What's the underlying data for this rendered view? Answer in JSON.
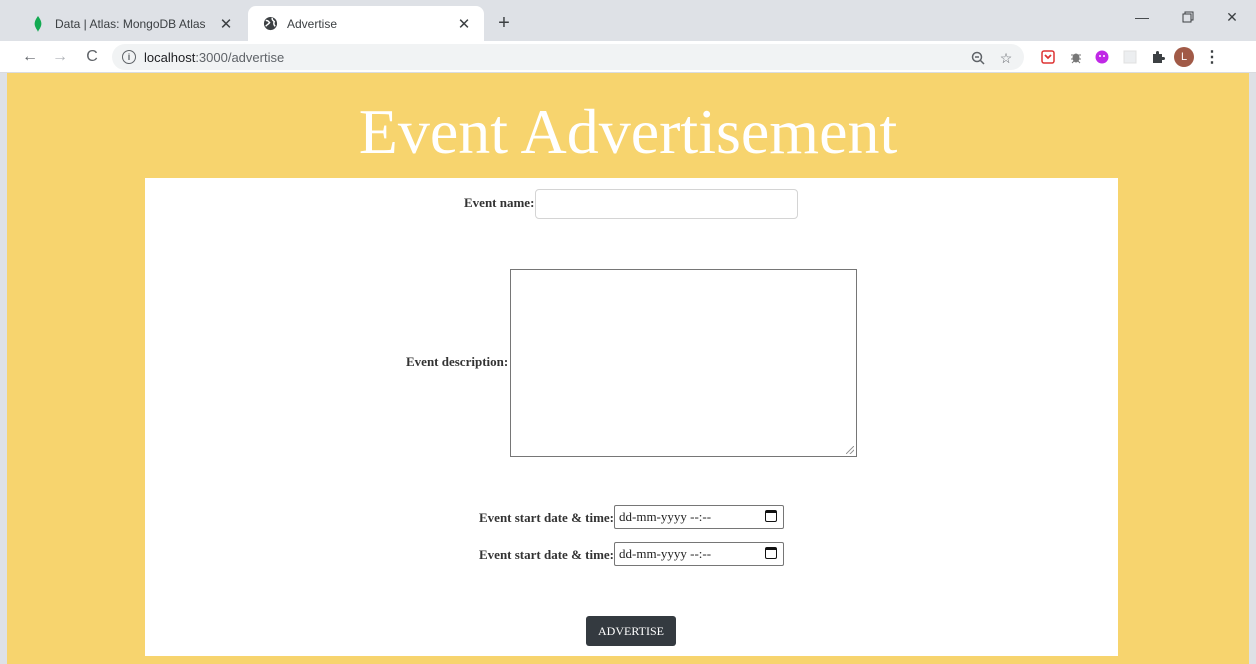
{
  "browser": {
    "tabs": [
      {
        "title": "Data | Atlas: MongoDB Atlas",
        "active": false,
        "icon": "mongodb-leaf-icon"
      },
      {
        "title": "Advertise",
        "active": true,
        "icon": "globe-icon"
      }
    ],
    "url_host": "localhost",
    "url_path": ":3000/advertise",
    "profile_initial": "L"
  },
  "page": {
    "title": "Event Advertisement",
    "form": {
      "event_name_label": "Event name:",
      "event_name_value": "",
      "event_description_label": "Event description:",
      "event_description_value": "",
      "start_label_1": "Event start date & time:",
      "start_placeholder_1": "dd-mm-yyyy --:--",
      "start_label_2": "Event start date & time:",
      "start_placeholder_2": "dd-mm-yyyy --:--",
      "submit_label": "ADVERTISE"
    }
  },
  "colors": {
    "page_background": "#f7d46e",
    "card_background": "#ffffff",
    "button_background": "#343a40",
    "title_color": "#ffffff"
  }
}
